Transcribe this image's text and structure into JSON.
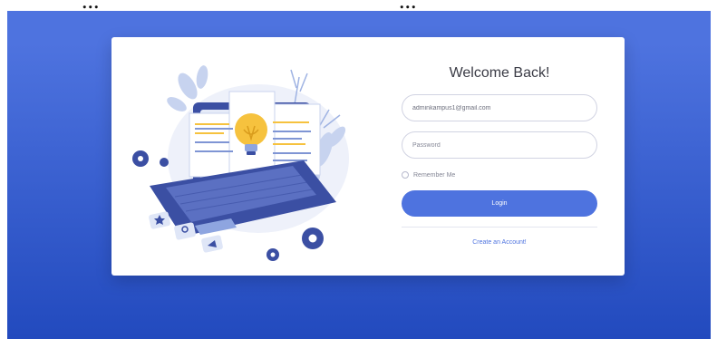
{
  "caption": {
    "left": "...",
    "right": "..."
  },
  "login": {
    "title": "Welcome Back!",
    "email_value": "adminkampus1@gmail.com",
    "password_placeholder": "Password",
    "remember_label": "Remember Me",
    "login_label": "Login",
    "create_account_label": "Create an Account!"
  },
  "colors": {
    "primary": "#4e73df",
    "primary_dark": "#224abe",
    "accent_yellow": "#f6c23e",
    "illustration_navy": "#3b4fa3",
    "illustration_light": "#dfe6f7"
  }
}
